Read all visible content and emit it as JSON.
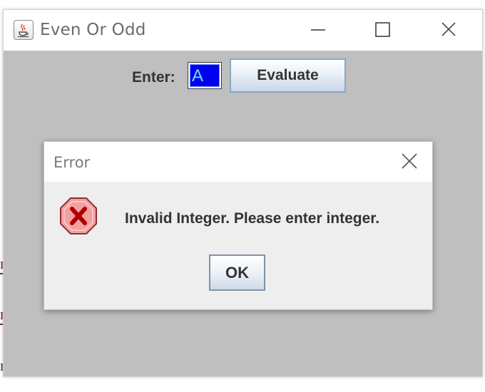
{
  "window": {
    "title": "Even Or Odd",
    "controls": [
      "minimize",
      "maximize",
      "close"
    ]
  },
  "form": {
    "enter_label": "Enter:",
    "input_value": "A",
    "evaluate_label": "Evaluate"
  },
  "background_text": [
    "n",
    "n",
    "n"
  ],
  "dialog": {
    "title": "Error",
    "message": "Invalid Integer. Please enter integer.",
    "ok_label": "OK",
    "icon": "error-icon"
  },
  "colors": {
    "input_selection": "#0000ee",
    "input_text": "#6fe0ff",
    "window_bg": "#bfbfbf",
    "error_icon_fill": "#f2a0a0",
    "error_icon_x": "#b00000"
  }
}
